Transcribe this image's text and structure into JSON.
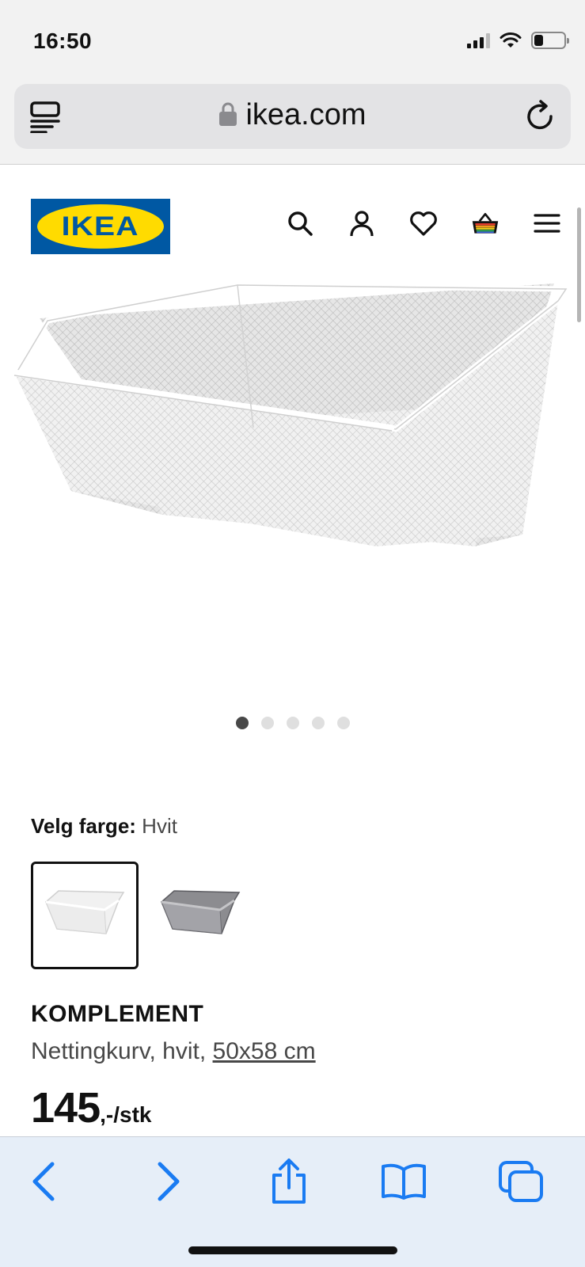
{
  "status_bar": {
    "time": "16:50",
    "battery_level": 0.3,
    "icons": [
      "cellular-signal-icon",
      "wifi-icon",
      "battery-icon"
    ]
  },
  "browser": {
    "url": "ikea.com",
    "left_icon": "reader-view-icon",
    "right_icon": "reload-icon"
  },
  "header": {
    "logo_text": "IKEA",
    "icons": [
      "search-icon",
      "account-icon",
      "heart-icon",
      "cart-icon",
      "menu-icon"
    ],
    "colors": {
      "logo_blue": "#0058a3",
      "logo_yellow": "#ffdb00"
    }
  },
  "carousel": {
    "total": 5,
    "active_index": 0
  },
  "product": {
    "color_label": "Velg farge:",
    "color_value": "Hvit",
    "swatches": [
      {
        "color": "Hvit",
        "selected": true
      },
      {
        "color": "Grå",
        "selected": false
      }
    ],
    "name": "KOMPLEMENT",
    "description": "Nettingkurv, hvit,",
    "size": "50x58 cm",
    "price": "145",
    "price_suffix": ",-/stk"
  },
  "toolbar": {
    "icons": [
      "back-icon",
      "forward-icon",
      "share-icon",
      "bookmarks-icon",
      "tabs-icon"
    ],
    "accent": "#1a7bf2"
  }
}
